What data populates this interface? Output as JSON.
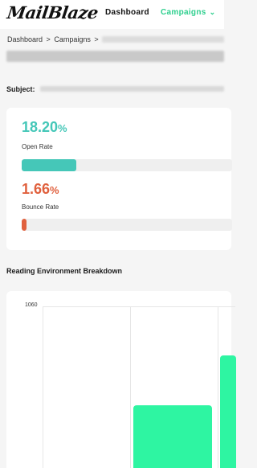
{
  "header": {
    "logo": "MailBlaze",
    "nav": {
      "dashboard": "Dashboard",
      "campaigns": "Campaigns"
    }
  },
  "breadcrumb": {
    "items": [
      "Dashboard",
      "Campaigns"
    ],
    "separator": ">"
  },
  "subject": {
    "label": "Subject:"
  },
  "metrics": {
    "open_rate": {
      "value": "18.20",
      "unit": "%",
      "label": "Open Rate",
      "fraction": 0.182,
      "color": "#45c7b8"
    },
    "bounce_rate": {
      "value": "1.66",
      "unit": "%",
      "label": "Bounce Rate",
      "fraction": 0.0166,
      "color": "#e0603d"
    }
  },
  "reading_environment": {
    "title": "Reading Environment Breakdown",
    "chart_data": {
      "type": "bar",
      "ylim": [
        0,
        1060
      ],
      "yticks": [
        "1060"
      ],
      "bar_color": "#2ef5a2"
    }
  }
}
